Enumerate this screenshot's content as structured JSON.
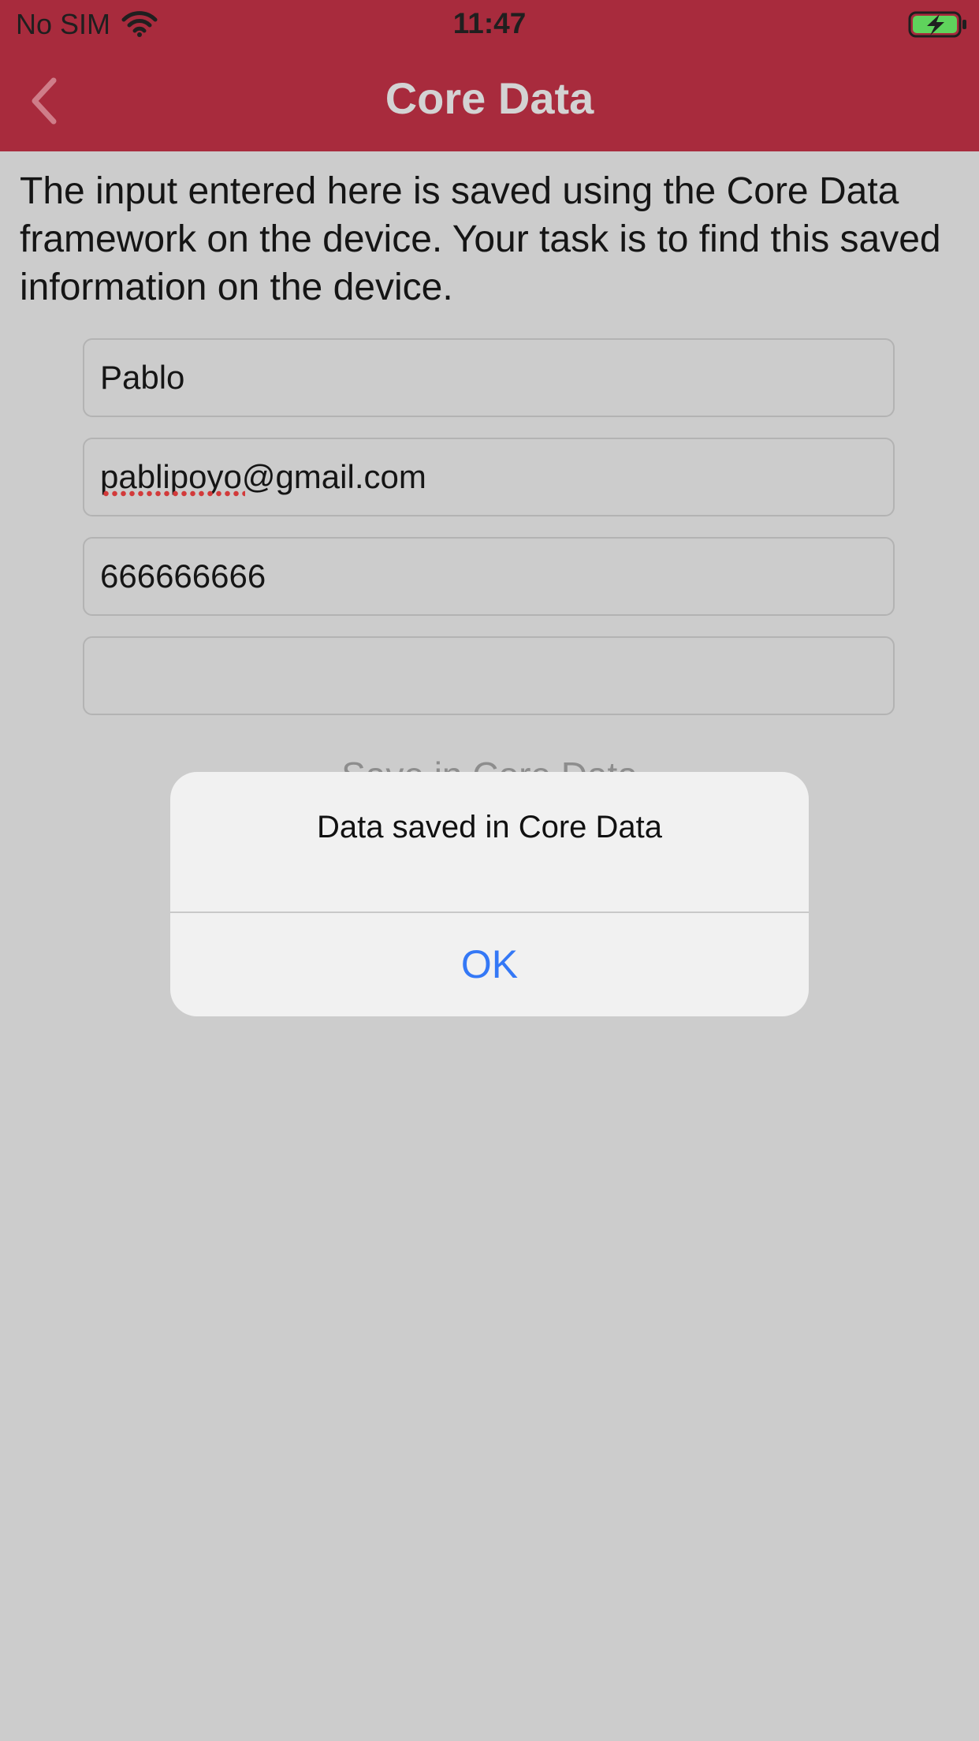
{
  "status_bar": {
    "carrier": "No SIM",
    "time": "11:47",
    "wifi_icon": "wifi-icon",
    "battery_icon": "battery-charging-icon"
  },
  "nav": {
    "title": "Core Data",
    "back_icon": "chevron-left-icon",
    "background_color": "#a82b3d"
  },
  "content": {
    "intro": "The input entered here is saved using the Core Data framework on the device. Your task is to find this saved information on the device.",
    "fields": {
      "name": "Pablo",
      "email": "pablipoyo@gmail.com",
      "phone": "666666666",
      "extra": ""
    },
    "save_button_label": "Save in Core Data"
  },
  "alert": {
    "message": "Data saved in Core Data",
    "ok_label": "OK",
    "ok_color": "#3478f6"
  }
}
